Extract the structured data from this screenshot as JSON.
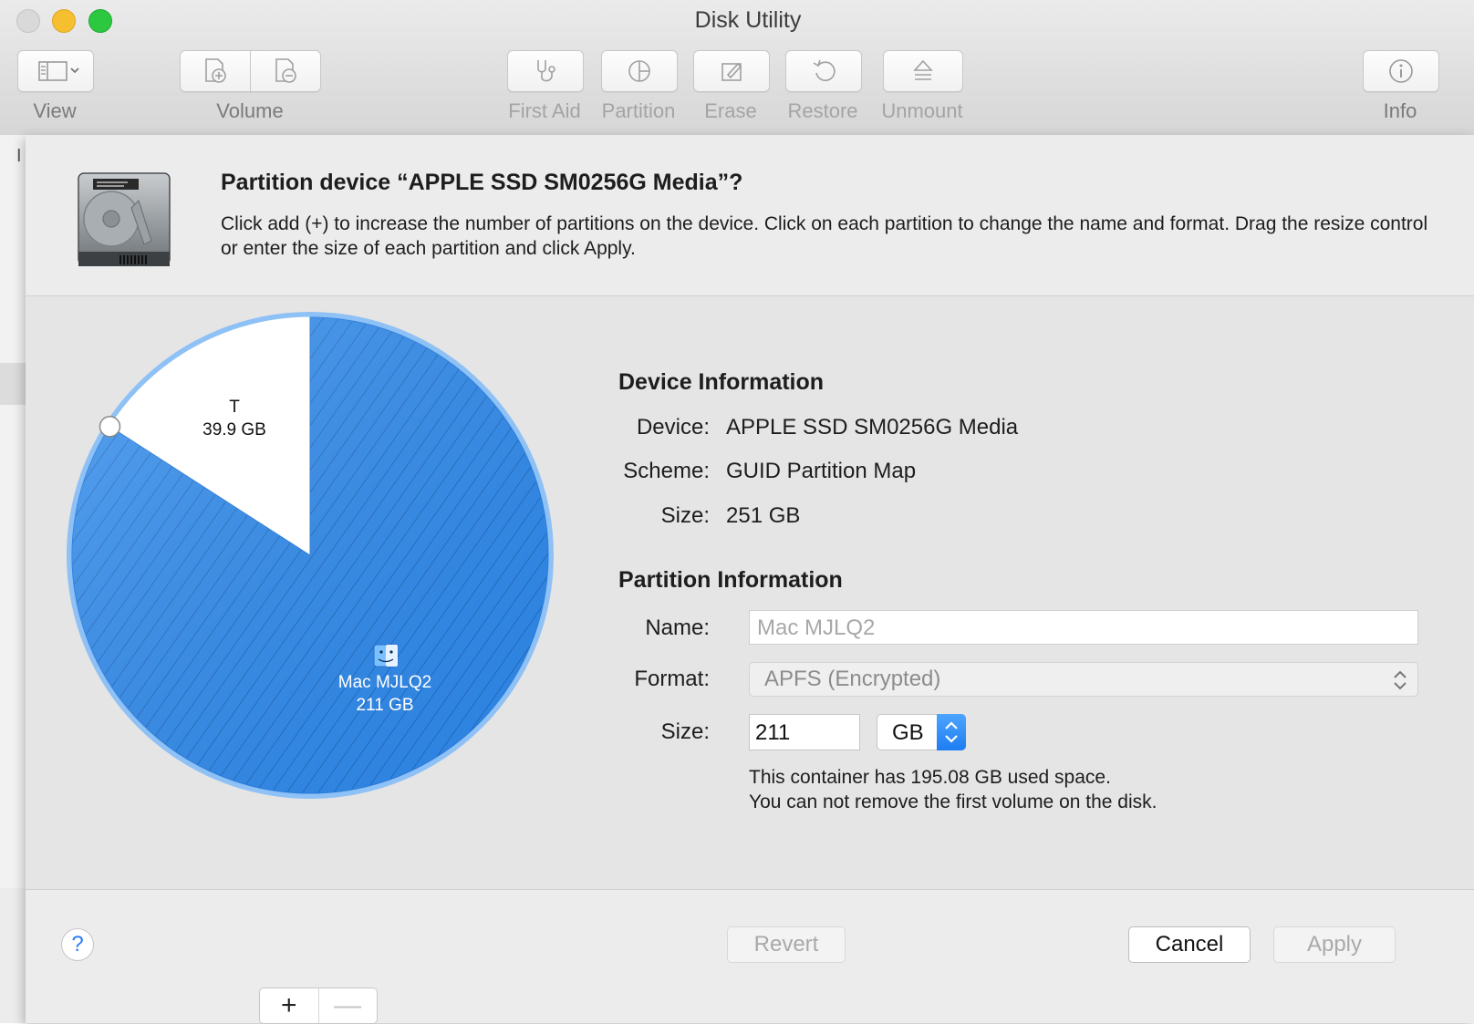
{
  "window": {
    "title": "Disk Utility"
  },
  "toolbar": {
    "view_label": "View",
    "volume_label": "Volume",
    "first_aid_label": "First Aid",
    "partition_label": "Partition",
    "erase_label": "Erase",
    "restore_label": "Restore",
    "unmount_label": "Unmount",
    "info_label": "Info"
  },
  "sidebar": {
    "glyph": "I"
  },
  "sheet": {
    "title": "Partition device “APPLE SSD SM0256G Media”?",
    "description": "Click add (+) to increase the number of partitions on the device. Click on each partition to change the name and format. Drag the resize control or enter the size of each partition and click Apply."
  },
  "pie": {
    "partitions": [
      {
        "name": "T",
        "size": "39.9 GB",
        "gb": 39.9,
        "selected": false
      },
      {
        "name": "Mac MJLQ2",
        "size": "211 GB",
        "gb": 211,
        "selected": true
      }
    ],
    "add_label": "+",
    "remove_label": "—"
  },
  "device_info": {
    "heading": "Device Information",
    "device_label": "Device:",
    "device_value": "APPLE SSD SM0256G Media",
    "scheme_label": "Scheme:",
    "scheme_value": "GUID Partition Map",
    "size_label": "Size:",
    "size_value": "251 GB"
  },
  "partition_info": {
    "heading": "Partition Information",
    "name_label": "Name:",
    "name_value": "Mac MJLQ2",
    "format_label": "Format:",
    "format_value": "APFS (Encrypted)",
    "size_label": "Size:",
    "size_value": "211",
    "unit_value": "GB",
    "note_1": "This container has 195.08 GB used space.",
    "note_2": "You can not remove the first volume on the disk."
  },
  "footer": {
    "help_label": "?",
    "revert_label": "Revert",
    "cancel_label": "Cancel",
    "apply_label": "Apply"
  },
  "colors": {
    "accent": "#2f8cf0",
    "pie_selected": "#2f8cf0",
    "pie_ring": "#8ec1f5",
    "pie_free": "#ffffff"
  }
}
